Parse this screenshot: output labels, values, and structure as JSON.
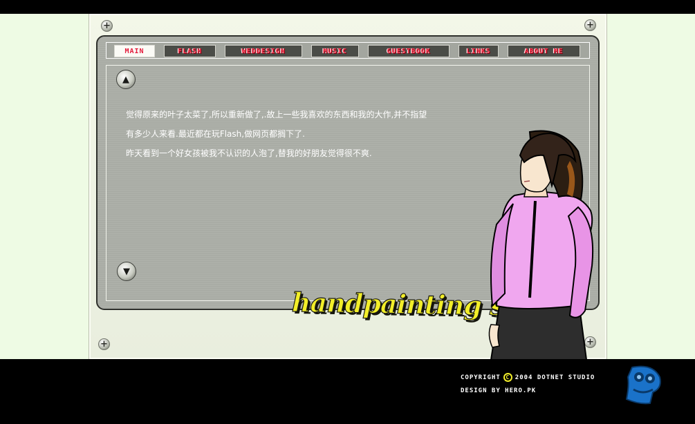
{
  "nav": {
    "items": [
      {
        "label": "MAIN",
        "active": true
      },
      {
        "label": "FLASH",
        "active": false
      },
      {
        "label": "WEDDESIGN",
        "active": false
      },
      {
        "label": "MUSIC",
        "active": false
      },
      {
        "label": "GUESTBOOK",
        "active": false
      },
      {
        "label": "LINKS",
        "active": false
      },
      {
        "label": "ABOUT ME",
        "active": false
      }
    ]
  },
  "content": {
    "lines": [
      "觉得原来的叶子太菜了,所以重新做了,.故上一些我喜欢的东西和我的大作,并不指望",
      "有多少人来看.最近都在玩Flash,做网页都搁下了.",
      "昨天看到一个好女孩被我不认识的人泡了,替我的好朋友觉得很不爽."
    ]
  },
  "logo": {
    "text": "handpainting sky"
  },
  "footer": {
    "copyright_prefix": "COPYRIGHT",
    "copyright_symbol": "C",
    "copyright_suffix": "2004 DOTNET STUDIO",
    "design_credit": "DESIGN BY HERO.PK"
  },
  "icons": {
    "screw": "plus",
    "scroll_up": "triangle-up",
    "scroll_down": "triangle-down"
  },
  "colors": {
    "page_background": "#eefbe4",
    "nav_text": "#ff3d55",
    "logo_fill": "#f2ee29",
    "studio_logo": "#1a72c9",
    "shirt": "#f0a7ef"
  }
}
